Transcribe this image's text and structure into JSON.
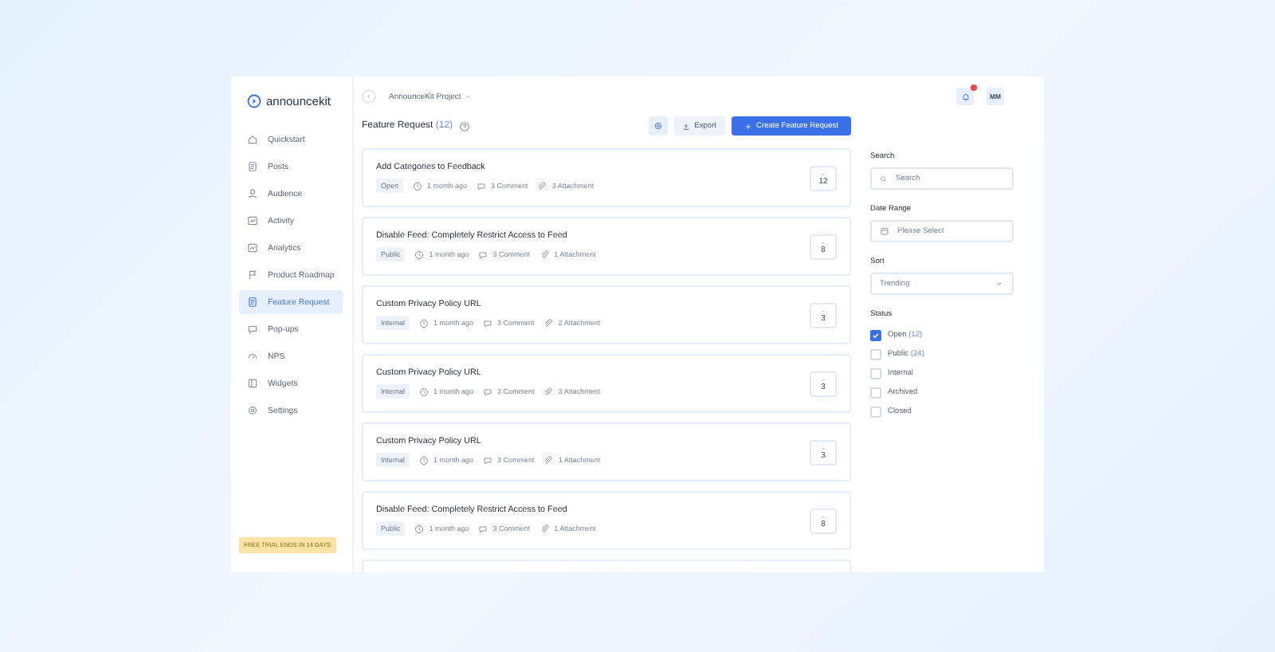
{
  "logo": {
    "name": "announcekit"
  },
  "project": {
    "name": "AnnounceKit Project"
  },
  "user": {
    "initials": "MM"
  },
  "notifications": {
    "unread": true
  },
  "sidebar": {
    "items": [
      {
        "label": "Quickstart",
        "selected": false
      },
      {
        "label": "Posts",
        "selected": false
      },
      {
        "label": "Audience",
        "selected": false
      },
      {
        "label": "Activity",
        "selected": false
      },
      {
        "label": "Analytics",
        "selected": false
      },
      {
        "label": "Product Roadmap",
        "selected": false
      },
      {
        "label": "Feature Request",
        "selected": true
      },
      {
        "label": "Pop-ups",
        "selected": false
      },
      {
        "label": "NPS",
        "selected": false
      },
      {
        "label": "Widgets",
        "selected": false
      },
      {
        "label": "Settings",
        "selected": false
      }
    ],
    "trial": "FREE TRIAL ENDS IN 14 DAYS"
  },
  "header": {
    "title": "Feature Request",
    "count": "(12)",
    "export": "Export",
    "create": "Create Feature Request"
  },
  "requests": [
    {
      "title": "Add Categories to Feedback",
      "status": "Open",
      "time": "1 month ago",
      "comments": "3 Comment",
      "attachments": "3 Attachment",
      "votes": "12"
    },
    {
      "title": "Disable Feed: Completely Restrict Access to Feed",
      "status": "Public",
      "time": "1 month ago",
      "comments": "3 Comment",
      "attachments": "1 Attachment",
      "votes": "8"
    },
    {
      "title": "Custom Privacy Policy URL",
      "status": "Internal",
      "time": "1 month ago",
      "comments": "3 Comment",
      "attachments": "2 Attachment",
      "votes": "3"
    },
    {
      "title": "Custom Privacy Policy URL",
      "status": "Internal",
      "time": "1 month ago",
      "comments": "3 Comment",
      "attachments": "3 Attachment",
      "votes": "3"
    },
    {
      "title": "Custom Privacy Policy URL",
      "status": "Internal",
      "time": "1 month ago",
      "comments": "3 Comment",
      "attachments": "1 Attachment",
      "votes": "3"
    },
    {
      "title": "Disable Feed: Completely Restrict Access to Feed",
      "status": "Public",
      "time": "1 month ago",
      "comments": "3 Comment",
      "attachments": "1 Attachment",
      "votes": "8"
    }
  ],
  "filters": {
    "search_label": "Search",
    "search_placeholder": "Search",
    "date_label": "Date Range",
    "date_placeholder": "Please Select",
    "sort_label": "Sort",
    "sort_value": "Trending",
    "status_label": "Status",
    "statuses": [
      {
        "label": "Open",
        "count": "(12)",
        "checked": true
      },
      {
        "label": "Public",
        "count": "(24)",
        "checked": false
      },
      {
        "label": "Internal",
        "checked": false
      },
      {
        "label": "Archived",
        "checked": false
      },
      {
        "label": "Closed",
        "checked": false
      }
    ]
  }
}
